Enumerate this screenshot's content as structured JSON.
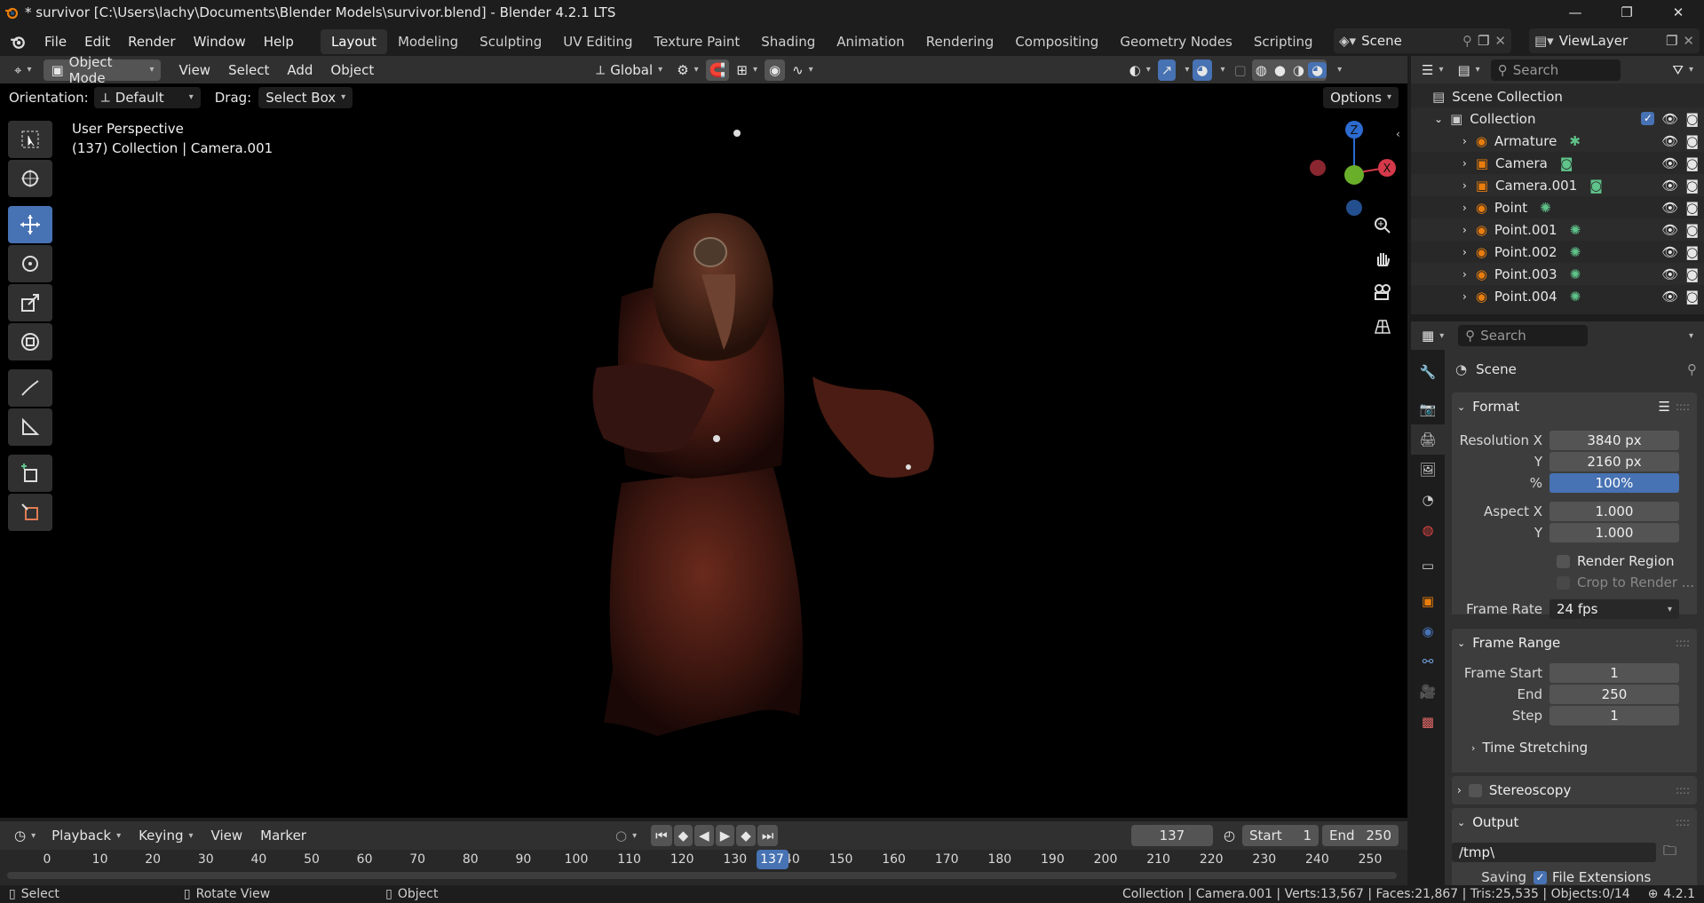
{
  "window": {
    "title": "* survivor [C:\\Users\\lachy\\Documents\\Blender Models\\survivor.blend] - Blender 4.2.1 LTS",
    "controls": [
      "—",
      "❐",
      "✕"
    ]
  },
  "menubar": {
    "items": [
      "File",
      "Edit",
      "Render",
      "Window",
      "Help"
    ],
    "workspaces": [
      "Layout",
      "Modeling",
      "Sculpting",
      "UV Editing",
      "Texture Paint",
      "Shading",
      "Animation",
      "Rendering",
      "Compositing",
      "Geometry Nodes",
      "Scripting"
    ],
    "active_workspace": "Layout",
    "scene": "Scene",
    "view_layer": "ViewLayer"
  },
  "viewport_header": {
    "mode": "Object Mode",
    "menus": [
      "View",
      "Select",
      "Add",
      "Object"
    ],
    "transform_orientation": "Global",
    "orientation_label": "Orientation:",
    "orientation_value": "Default",
    "drag_label": "Drag:",
    "drag_value": "Select Box",
    "options": "Options"
  },
  "viewport": {
    "perspective": "User Perspective",
    "context": "(137) Collection | Camera.001",
    "gizmo": {
      "z": "Z",
      "x": "X"
    }
  },
  "timeline": {
    "menus": [
      "Playback",
      "Keying",
      "View",
      "Marker"
    ],
    "current_frame": "137",
    "start_label": "Start",
    "start": "1",
    "end_label": "End",
    "end": "250",
    "ticks": [
      "0",
      "10",
      "20",
      "30",
      "40",
      "50",
      "60",
      "70",
      "80",
      "90",
      "100",
      "110",
      "120",
      "130",
      "140",
      "150",
      "160",
      "170",
      "180",
      "190",
      "200",
      "210",
      "220",
      "230",
      "240",
      "250"
    ],
    "playhead": "137"
  },
  "statusbar": {
    "select": "Select",
    "rotate": "Rotate View",
    "object": "Object",
    "stats": "Collection | Camera.001 | Verts:13,567 | Faces:21,867 | Tris:25,535 | Objects:0/14",
    "version": "4.2.1"
  },
  "outliner": {
    "search_placeholder": "Search",
    "root": "Scene Collection",
    "collection": "Collection",
    "items": [
      {
        "name": "Armature",
        "type": "armature"
      },
      {
        "name": "Camera",
        "type": "camera"
      },
      {
        "name": "Camera.001",
        "type": "camera"
      },
      {
        "name": "Point",
        "type": "light"
      },
      {
        "name": "Point.001",
        "type": "light"
      },
      {
        "name": "Point.002",
        "type": "light"
      },
      {
        "name": "Point.003",
        "type": "light"
      },
      {
        "name": "Point.004",
        "type": "light"
      }
    ]
  },
  "properties": {
    "search_placeholder": "Search",
    "context": "Scene",
    "format": {
      "title": "Format",
      "resolution_x_label": "Resolution X",
      "resolution_x": "3840 px",
      "y_label": "Y",
      "resolution_y": "2160 px",
      "percent_label": "%",
      "percent": "100%",
      "aspect_x_label": "Aspect X",
      "aspect_x": "1.000",
      "aspect_y_label": "Y",
      "aspect_y": "1.000",
      "render_region": "Render Region",
      "crop_to_render": "Crop to Render ...",
      "frame_rate_label": "Frame Rate",
      "frame_rate": "24 fps"
    },
    "frame_range": {
      "title": "Frame Range",
      "start_label": "Frame Start",
      "start": "1",
      "end_label": "End",
      "end": "250",
      "step_label": "Step",
      "step": "1",
      "time_stretching": "Time Stretching"
    },
    "stereoscopy": "Stereoscopy",
    "output": {
      "title": "Output",
      "path": "/tmp\\",
      "saving_label": "Saving",
      "file_extensions": "File Extensions"
    }
  }
}
